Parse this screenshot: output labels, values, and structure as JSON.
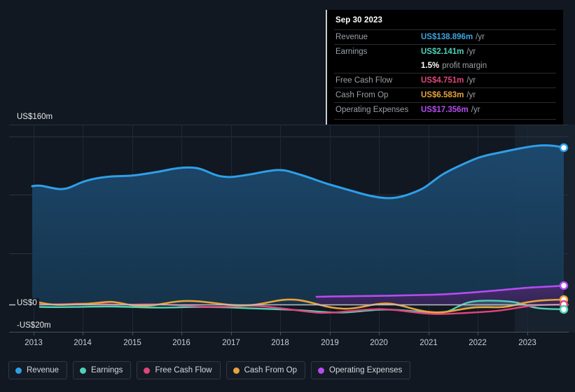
{
  "tooltip": {
    "title": "Sep 30 2023",
    "rows": [
      {
        "key": "Revenue",
        "value": "US$138.896m",
        "unit": "/yr",
        "color": "#3ba5e0"
      },
      {
        "key": "Earnings",
        "value": "US$2.141m",
        "unit": "/yr",
        "color": "#4fd1b8"
      },
      {
        "key": "",
        "value": "1.5%",
        "unit": "profit margin",
        "color": "#ffffff"
      },
      {
        "key": "Free Cash Flow",
        "value": "US$4.751m",
        "unit": "/yr",
        "color": "#e0457b"
      },
      {
        "key": "Cash From Op",
        "value": "US$6.583m",
        "unit": "/yr",
        "color": "#e8a33d"
      },
      {
        "key": "Operating Expenses",
        "value": "US$17.356m",
        "unit": "/yr",
        "color": "#b44cf0"
      }
    ]
  },
  "legend": {
    "items": [
      {
        "label": "Revenue",
        "color": "#2f9fe8"
      },
      {
        "label": "Earnings",
        "color": "#4fd1b8"
      },
      {
        "label": "Free Cash Flow",
        "color": "#e0457b"
      },
      {
        "label": "Cash From Op",
        "color": "#e8a33d"
      },
      {
        "label": "Operating Expenses",
        "color": "#b44cf0"
      }
    ]
  },
  "axis": {
    "y_top_label": "US$160m",
    "y_zero_label": "US$0",
    "y_neg_label": "-US$20m",
    "x_labels": [
      "2013",
      "2014",
      "2015",
      "2016",
      "2017",
      "2018",
      "2019",
      "2020",
      "2021",
      "2022",
      "2023"
    ]
  },
  "chart_data": {
    "type": "area",
    "title": "",
    "xlabel": "",
    "ylabel": "US$m",
    "ylim": [
      -20,
      160
    ],
    "grid": true,
    "legend_position": "bottom",
    "x": [
      "2013",
      "2014",
      "2015",
      "2016",
      "2017",
      "2018",
      "2019",
      "2020",
      "2021",
      "2022",
      "2023",
      "Sep 30 2023"
    ],
    "annotations": [
      "Sep 30 2023 highlighted period"
    ],
    "series": [
      {
        "name": "Revenue",
        "color": "#2f9fe8",
        "values": [
          92,
          90,
          96,
          100,
          99,
          100,
          104,
          108,
          110,
          106,
          104,
          106,
          109,
          112,
          118,
          113,
          108,
          104,
          95,
          101,
          115,
          126,
          133,
          138.896
        ],
        "last_value": 138.896
      },
      {
        "name": "Earnings",
        "color": "#4fd1b8",
        "values": [
          -1.5,
          -1.8,
          -1.2,
          -1.0,
          -1.6,
          -1.4,
          -1.0,
          -1.2,
          -1.5,
          -2.0,
          -2.4,
          -2.2,
          -2.6,
          -3.0,
          -2.4,
          -1.6,
          -2.8,
          -1.4,
          4.5,
          5.2,
          5.0,
          2.0,
          1.8,
          2.141
        ],
        "last_value": 2.141
      },
      {
        "name": "Free Cash Flow",
        "color": "#e0457b",
        "values": [
          0.5,
          0.2,
          0.8,
          1.2,
          0.4,
          0.9,
          1.1,
          0.6,
          -0.5,
          -1.2,
          -2.0,
          -1.0,
          -0.4,
          -1.8,
          -3.2,
          -2.0,
          -3.6,
          -2.8,
          -2.2,
          -1.0,
          1.5,
          3.8,
          4.2,
          4.751
        ],
        "last_value": 4.751
      },
      {
        "name": "Cash From Op",
        "color": "#e8a33d",
        "values": [
          3.0,
          1.5,
          2.0,
          2.6,
          1.8,
          2.4,
          3.0,
          2.2,
          1.0,
          0.4,
          1.2,
          2.8,
          4.0,
          3.2,
          1.4,
          2.6,
          0.2,
          -0.8,
          -1.4,
          0.6,
          3.0,
          5.5,
          6.2,
          6.583
        ],
        "last_value": 6.583
      },
      {
        "name": "Operating Expenses",
        "color": "#b44cf0",
        "start_x": "2018.7",
        "values": [
          11.5,
          11.6,
          11.8,
          11.9,
          12.0,
          12.1,
          12.3,
          12.6,
          13.2,
          14.4,
          15.8,
          16.8,
          17.356
        ],
        "last_value": 17.356
      }
    ]
  }
}
